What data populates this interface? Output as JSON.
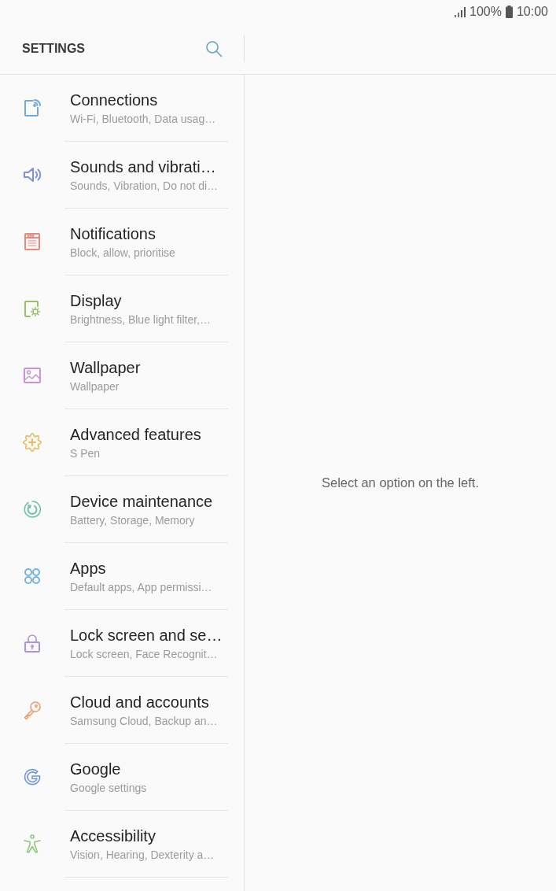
{
  "status_bar": {
    "battery": "100%",
    "time": "10:00"
  },
  "header": {
    "title": "SETTINGS"
  },
  "items": [
    {
      "title": "Connections",
      "subtitle": "Wi-Fi, Bluetooth, Data usag…",
      "color": "#72a9dc"
    },
    {
      "title": "Sounds and vibrati…",
      "subtitle": "Sounds, Vibration, Do not di…",
      "color": "#7b8fdc"
    },
    {
      "title": "Notifications",
      "subtitle": "Block, allow, prioritise",
      "color": "#e8877a"
    },
    {
      "title": "Display",
      "subtitle": "Brightness, Blue light filter,…",
      "color": "#9cbf6b"
    },
    {
      "title": "Wallpaper",
      "subtitle": "Wallpaper",
      "color": "#c994d6"
    },
    {
      "title": "Advanced features",
      "subtitle": "S Pen",
      "color": "#edb95a"
    },
    {
      "title": "Device maintenance",
      "subtitle": "Battery, Storage, Memory",
      "color": "#6fc3a8"
    },
    {
      "title": "Apps",
      "subtitle": "Default apps, App permissi…",
      "color": "#72b4e0"
    },
    {
      "title": "Lock screen and se…",
      "subtitle": "Lock screen, Face Recognit…",
      "color": "#a894e0"
    },
    {
      "title": "Cloud and accounts",
      "subtitle": "Samsung Cloud, Backup an…",
      "color": "#f09a6b"
    },
    {
      "title": "Google",
      "subtitle": "Google settings",
      "color": "#6a95df"
    },
    {
      "title": "Accessibility",
      "subtitle": "Vision, Hearing, Dexterity a…",
      "color": "#8cc97e"
    }
  ],
  "detail": {
    "message": "Select an option on the left."
  }
}
